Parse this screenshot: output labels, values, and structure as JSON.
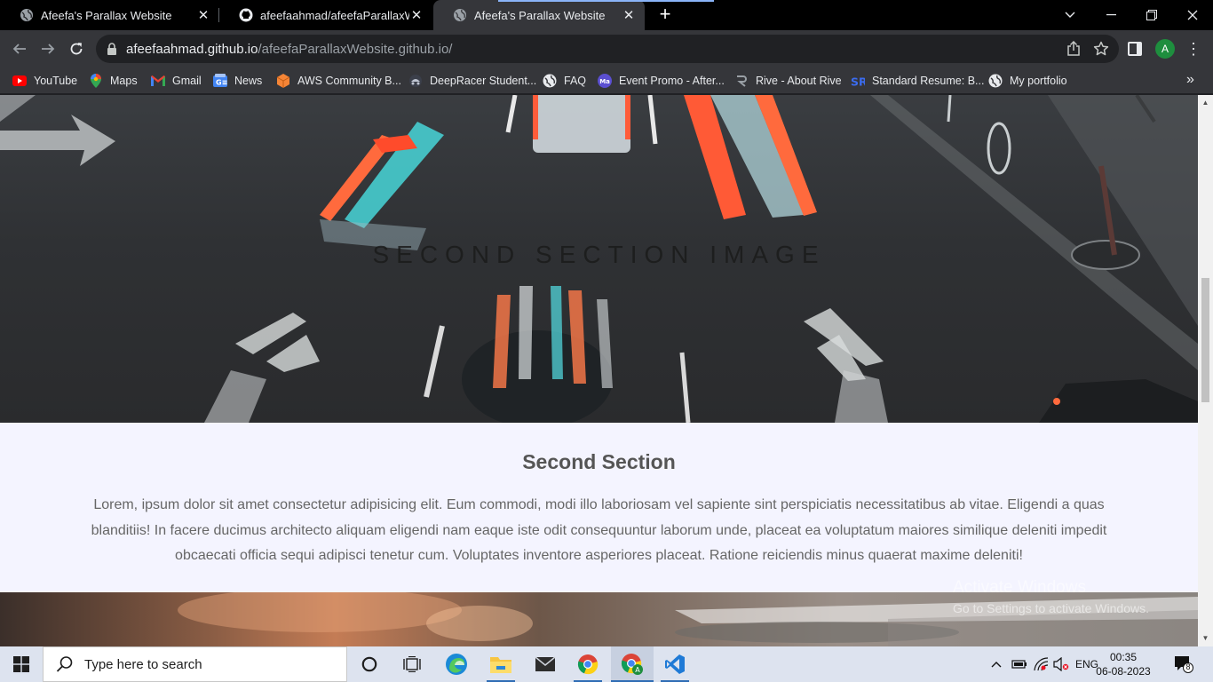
{
  "tabs": [
    {
      "title": "Afeefa's Parallax Website",
      "icon": "globe-icon",
      "active": false
    },
    {
      "title": "afeefaahmad/afeefaParallaxWebsite",
      "icon": "github-icon",
      "active": false
    },
    {
      "title": "Afeefa's Parallax Website",
      "icon": "globe-icon",
      "active": true
    }
  ],
  "toolbar": {
    "url_host": "afeefaahmad.github.io",
    "url_path": "/afeefaParallaxWebsite.github.io/",
    "profile_initial": "A"
  },
  "bookmarks": [
    {
      "label": "YouTube",
      "icon": "youtube-icon"
    },
    {
      "label": "Maps",
      "icon": "maps-icon"
    },
    {
      "label": "Gmail",
      "icon": "gmail-icon"
    },
    {
      "label": "News",
      "icon": "news-icon"
    },
    {
      "label": "AWS Community B...",
      "icon": "aws-icon"
    },
    {
      "label": "DeepRacer Student...",
      "icon": "deepracer-icon"
    },
    {
      "label": "FAQ",
      "icon": "globe-icon"
    },
    {
      "label": "Event Promo - After...",
      "icon": "event-icon"
    },
    {
      "label": "Rive - About Rive",
      "icon": "rive-icon"
    },
    {
      "label": "Standard Resume: B...",
      "icon": "resume-icon"
    },
    {
      "label": "My portfolio",
      "icon": "globe-icon"
    }
  ],
  "page": {
    "hero_caption": "SECOND SECTION IMAGE",
    "section_title": "Second Section",
    "section_text": "Lorem, ipsum dolor sit amet consectetur adipisicing elit. Eum commodi, modi illo laboriosam vel sapiente sint perspiciatis necessitatibus ab vitae. Eligendi a quas blanditiis! In facere ducimus architecto aliquam eligendi nam eaque iste odit consequuntur laborum unde, placeat ea voluptatum maiores similique deleniti impedit obcaecati officia sequi adipisci tenetur cum. Voluptates inventore asperiores placeat. Ratione reiciendis minus quaerat maxime deleniti!"
  },
  "watermark": {
    "line1": "Activate Windows",
    "line2": "Go to Settings to activate Windows."
  },
  "taskbar": {
    "search_placeholder": "Type here to search",
    "language": "ENG",
    "time": "00:35",
    "date": "06-08-2023",
    "notification_count": "8"
  },
  "colors": {
    "accent_blue": "#8ab4f8",
    "page_bg": "#f4f4ff",
    "taskbar_bg": "#dde3ef"
  }
}
